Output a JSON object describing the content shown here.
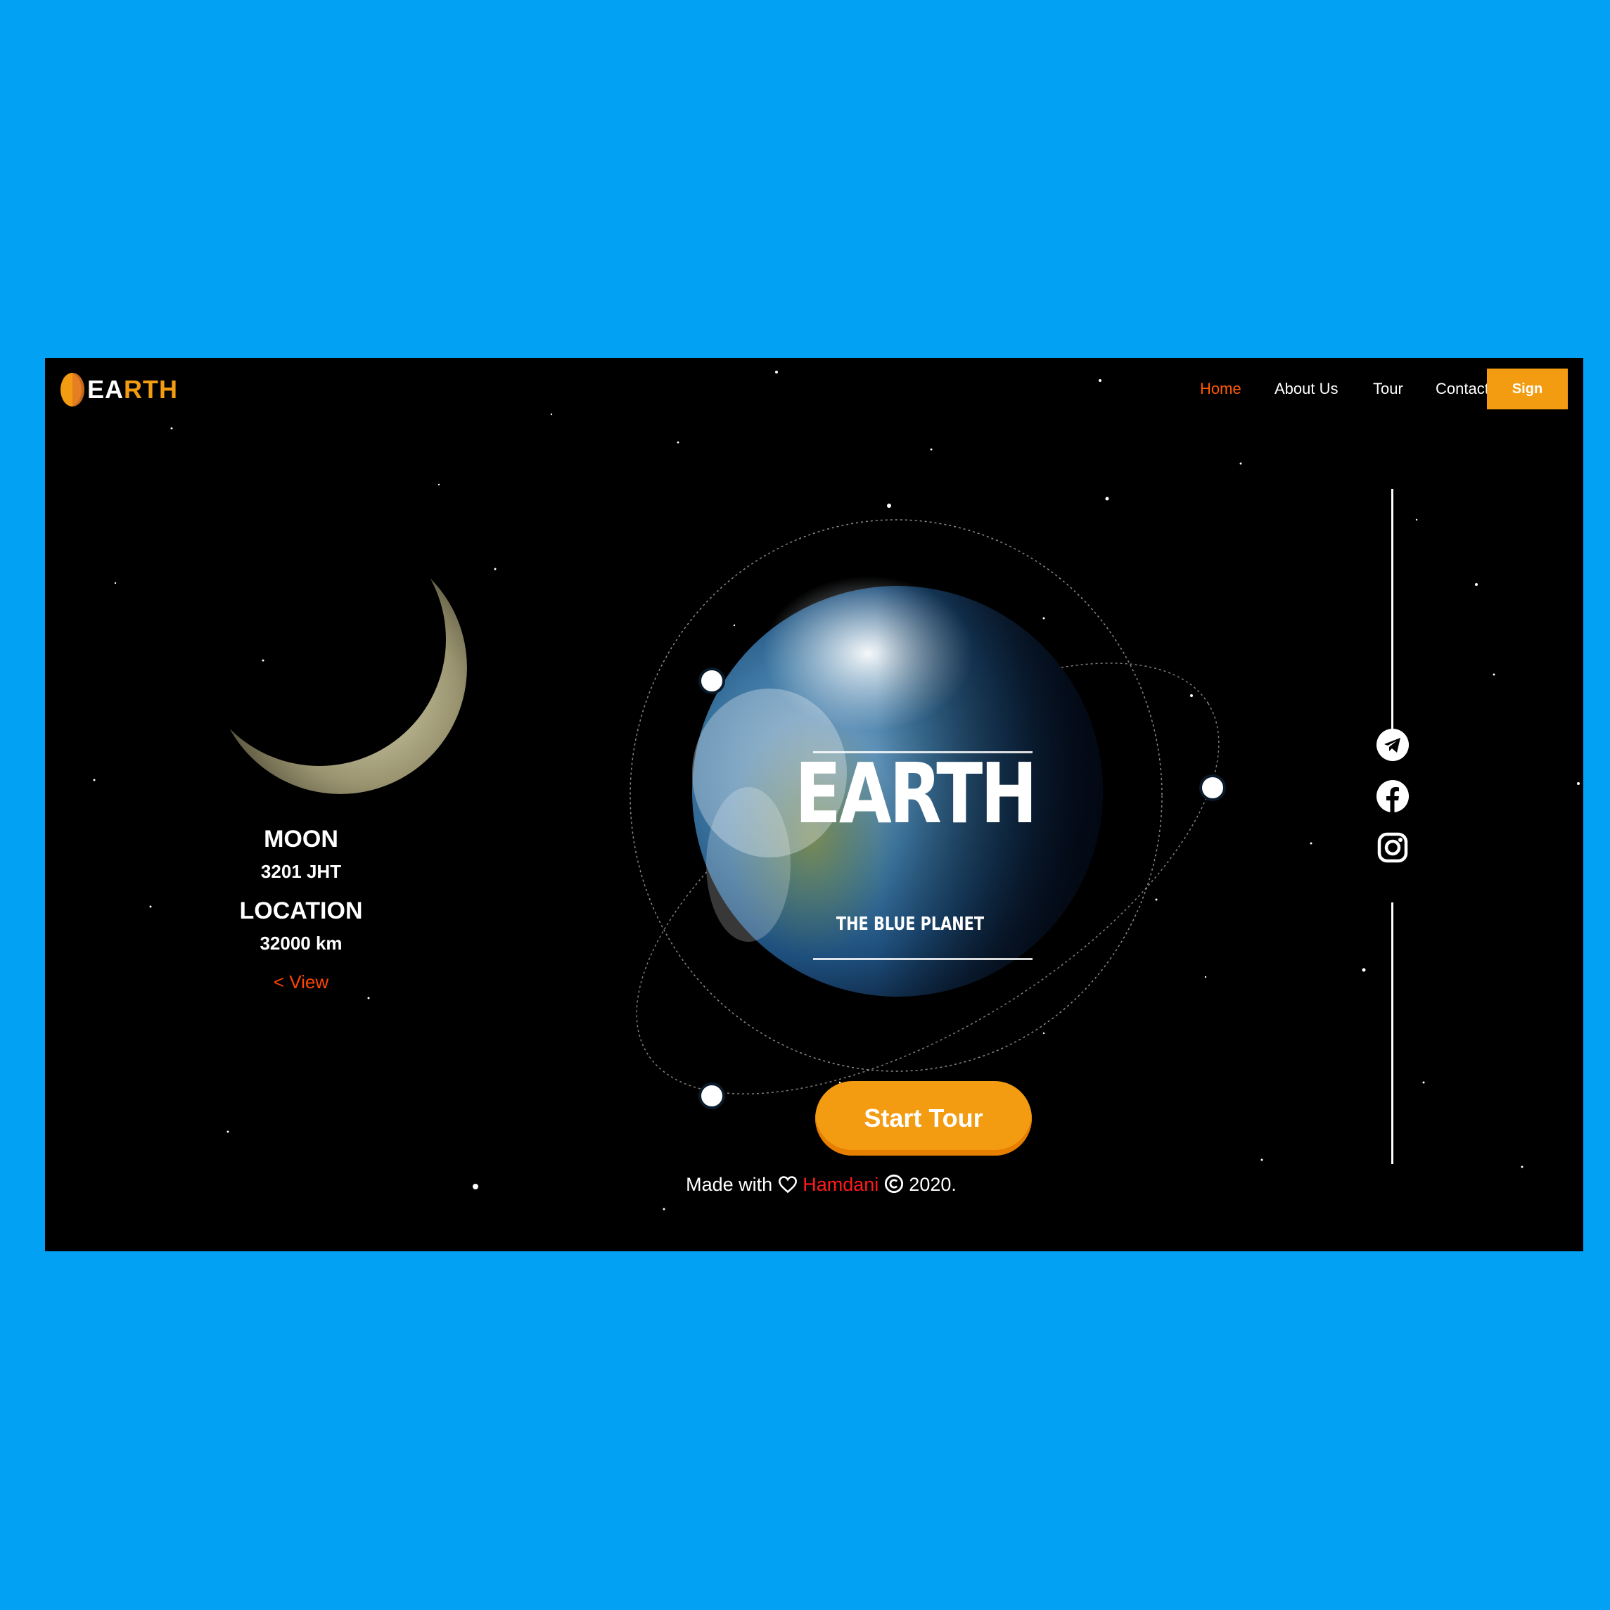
{
  "header": {
    "logo_text_white": "EA",
    "logo_text_orange": "RTH",
    "nav": [
      {
        "label": "Home",
        "active": true
      },
      {
        "label": "About Us",
        "active": false
      },
      {
        "label": "Tour",
        "active": false
      },
      {
        "label": "Contact Us",
        "active": false
      }
    ],
    "sign_label": "Sign"
  },
  "moon_info": {
    "name": "MOON",
    "name_value": "3201 JHT",
    "location_label": "LOCATION",
    "location_value": "32000 km",
    "view_link": "< View"
  },
  "hero": {
    "title": "EARTH",
    "subtitle": "THE BLUE PLANET",
    "cta_label": "Start Tour"
  },
  "footer": {
    "prefix": "Made with",
    "author": "Hamdani",
    "suffix": "2020."
  },
  "social_icons": [
    "telegram-icon",
    "facebook-icon",
    "instagram-icon"
  ],
  "colors": {
    "page_background": "#03a1f4",
    "accent_orange": "#f39c12",
    "nav_active": "#ff5a00",
    "author_red": "#ff1a1a"
  }
}
